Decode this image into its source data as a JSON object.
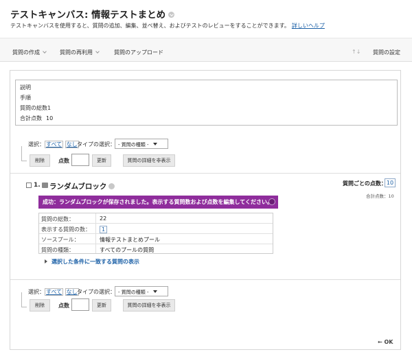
{
  "header": {
    "title": "テストキャンバス: 情報テストまとめ",
    "description": "テストキャンバスを使用すると、質問の追加、編集、並べ替え、およびテストのレビューをすることができます。",
    "help_link": "詳しいヘルプ"
  },
  "actionbar": {
    "create": "質問の作成",
    "reuse": "質問の再利用",
    "upload": "質問のアップロード",
    "settings": "質問の設定",
    "sort_icon": "↑↓"
  },
  "info": {
    "description_label": "説明",
    "instructions_label": "手順",
    "total_questions_label": "質問の総数",
    "total_questions_value": "1",
    "total_points_label": "合計点数",
    "total_points_value": "10"
  },
  "controls": {
    "select_label": "選択：",
    "select_all": "すべて",
    "select_none": "なし",
    "type_select_label": "タイプの選択：",
    "type_dropdown_value": "- 質問の種類 -",
    "delete_button": "削除",
    "points_label": "点数",
    "update_button": "更新",
    "hide_details_button": "質問の詳細を非表示"
  },
  "question": {
    "number": "1.",
    "title": "ランダムブロック",
    "points_per_question_label": "質問ごとの点数：",
    "points_per_question_value": "10",
    "total_points_text": "合計点数：10",
    "success_message": "成功：ランダムブロックが保存されました。表示する質問数および点数を編集してください。",
    "details": [
      {
        "key": "質問の総数：",
        "value": "22"
      },
      {
        "key": "表示する質問の数：",
        "value": "1"
      },
      {
        "key": "ソースプール：",
        "value": "情報テストまとめプール"
      },
      {
        "key": "質問の種類：",
        "value": "すべてのプールの質問"
      }
    ],
    "expand_link": "選択した条件に一致する質問の表示"
  },
  "footer": {
    "ok_button": "← OK"
  },
  "colors": {
    "success_bg": "#8f2d9c",
    "link": "#1a5fa6"
  }
}
